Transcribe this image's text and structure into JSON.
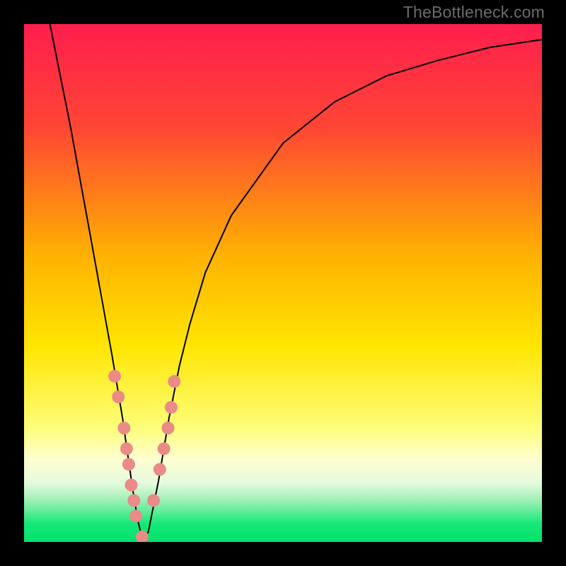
{
  "watermark": "TheBottleneck.com",
  "chart_data": {
    "type": "line",
    "title": "",
    "xlabel": "",
    "ylabel": "",
    "xlim": [
      0,
      100
    ],
    "ylim": [
      0,
      100
    ],
    "gradient_stops": [
      {
        "offset": 0.0,
        "color": "#ff1e4e"
      },
      {
        "offset": 0.2,
        "color": "#ff4634"
      },
      {
        "offset": 0.45,
        "color": "#ffb301"
      },
      {
        "offset": 0.62,
        "color": "#ffe501"
      },
      {
        "offset": 0.78,
        "color": "#fdfe7a"
      },
      {
        "offset": 0.84,
        "color": "#fefed0"
      },
      {
        "offset": 0.885,
        "color": "#e7fade"
      },
      {
        "offset": 0.92,
        "color": "#9df0b4"
      },
      {
        "offset": 0.965,
        "color": "#16e878"
      },
      {
        "offset": 1.0,
        "color": "#00e36a"
      }
    ],
    "series": [
      {
        "name": "bottleneck-curve",
        "x": [
          5,
          7,
          9,
          11,
          13,
          15,
          17,
          19,
          20,
          21,
          22,
          23,
          24,
          25,
          26,
          27,
          28,
          30,
          32,
          35,
          40,
          50,
          60,
          70,
          80,
          90,
          100
        ],
        "values": [
          100,
          90,
          80,
          69,
          58,
          47,
          36,
          24,
          17,
          10,
          4,
          0,
          2,
          7,
          12,
          18,
          24,
          34,
          42,
          52,
          63,
          77,
          85,
          90,
          93,
          95.5,
          97
        ]
      },
      {
        "name": "datapoints-left-branch",
        "x": [
          17.5,
          18.2,
          19.3,
          19.8,
          20.2,
          20.7,
          21.2,
          21.6,
          22.8
        ],
        "values": [
          32,
          28,
          22,
          18,
          15,
          11,
          8,
          5,
          1
        ]
      },
      {
        "name": "datapoints-right-branch",
        "x": [
          25.0,
          26.2,
          27.0,
          27.8,
          28.4,
          29.0
        ],
        "values": [
          8,
          14,
          18,
          22,
          26,
          31
        ]
      }
    ],
    "point_color": "#ea8b88",
    "curve_color": "#000000"
  }
}
